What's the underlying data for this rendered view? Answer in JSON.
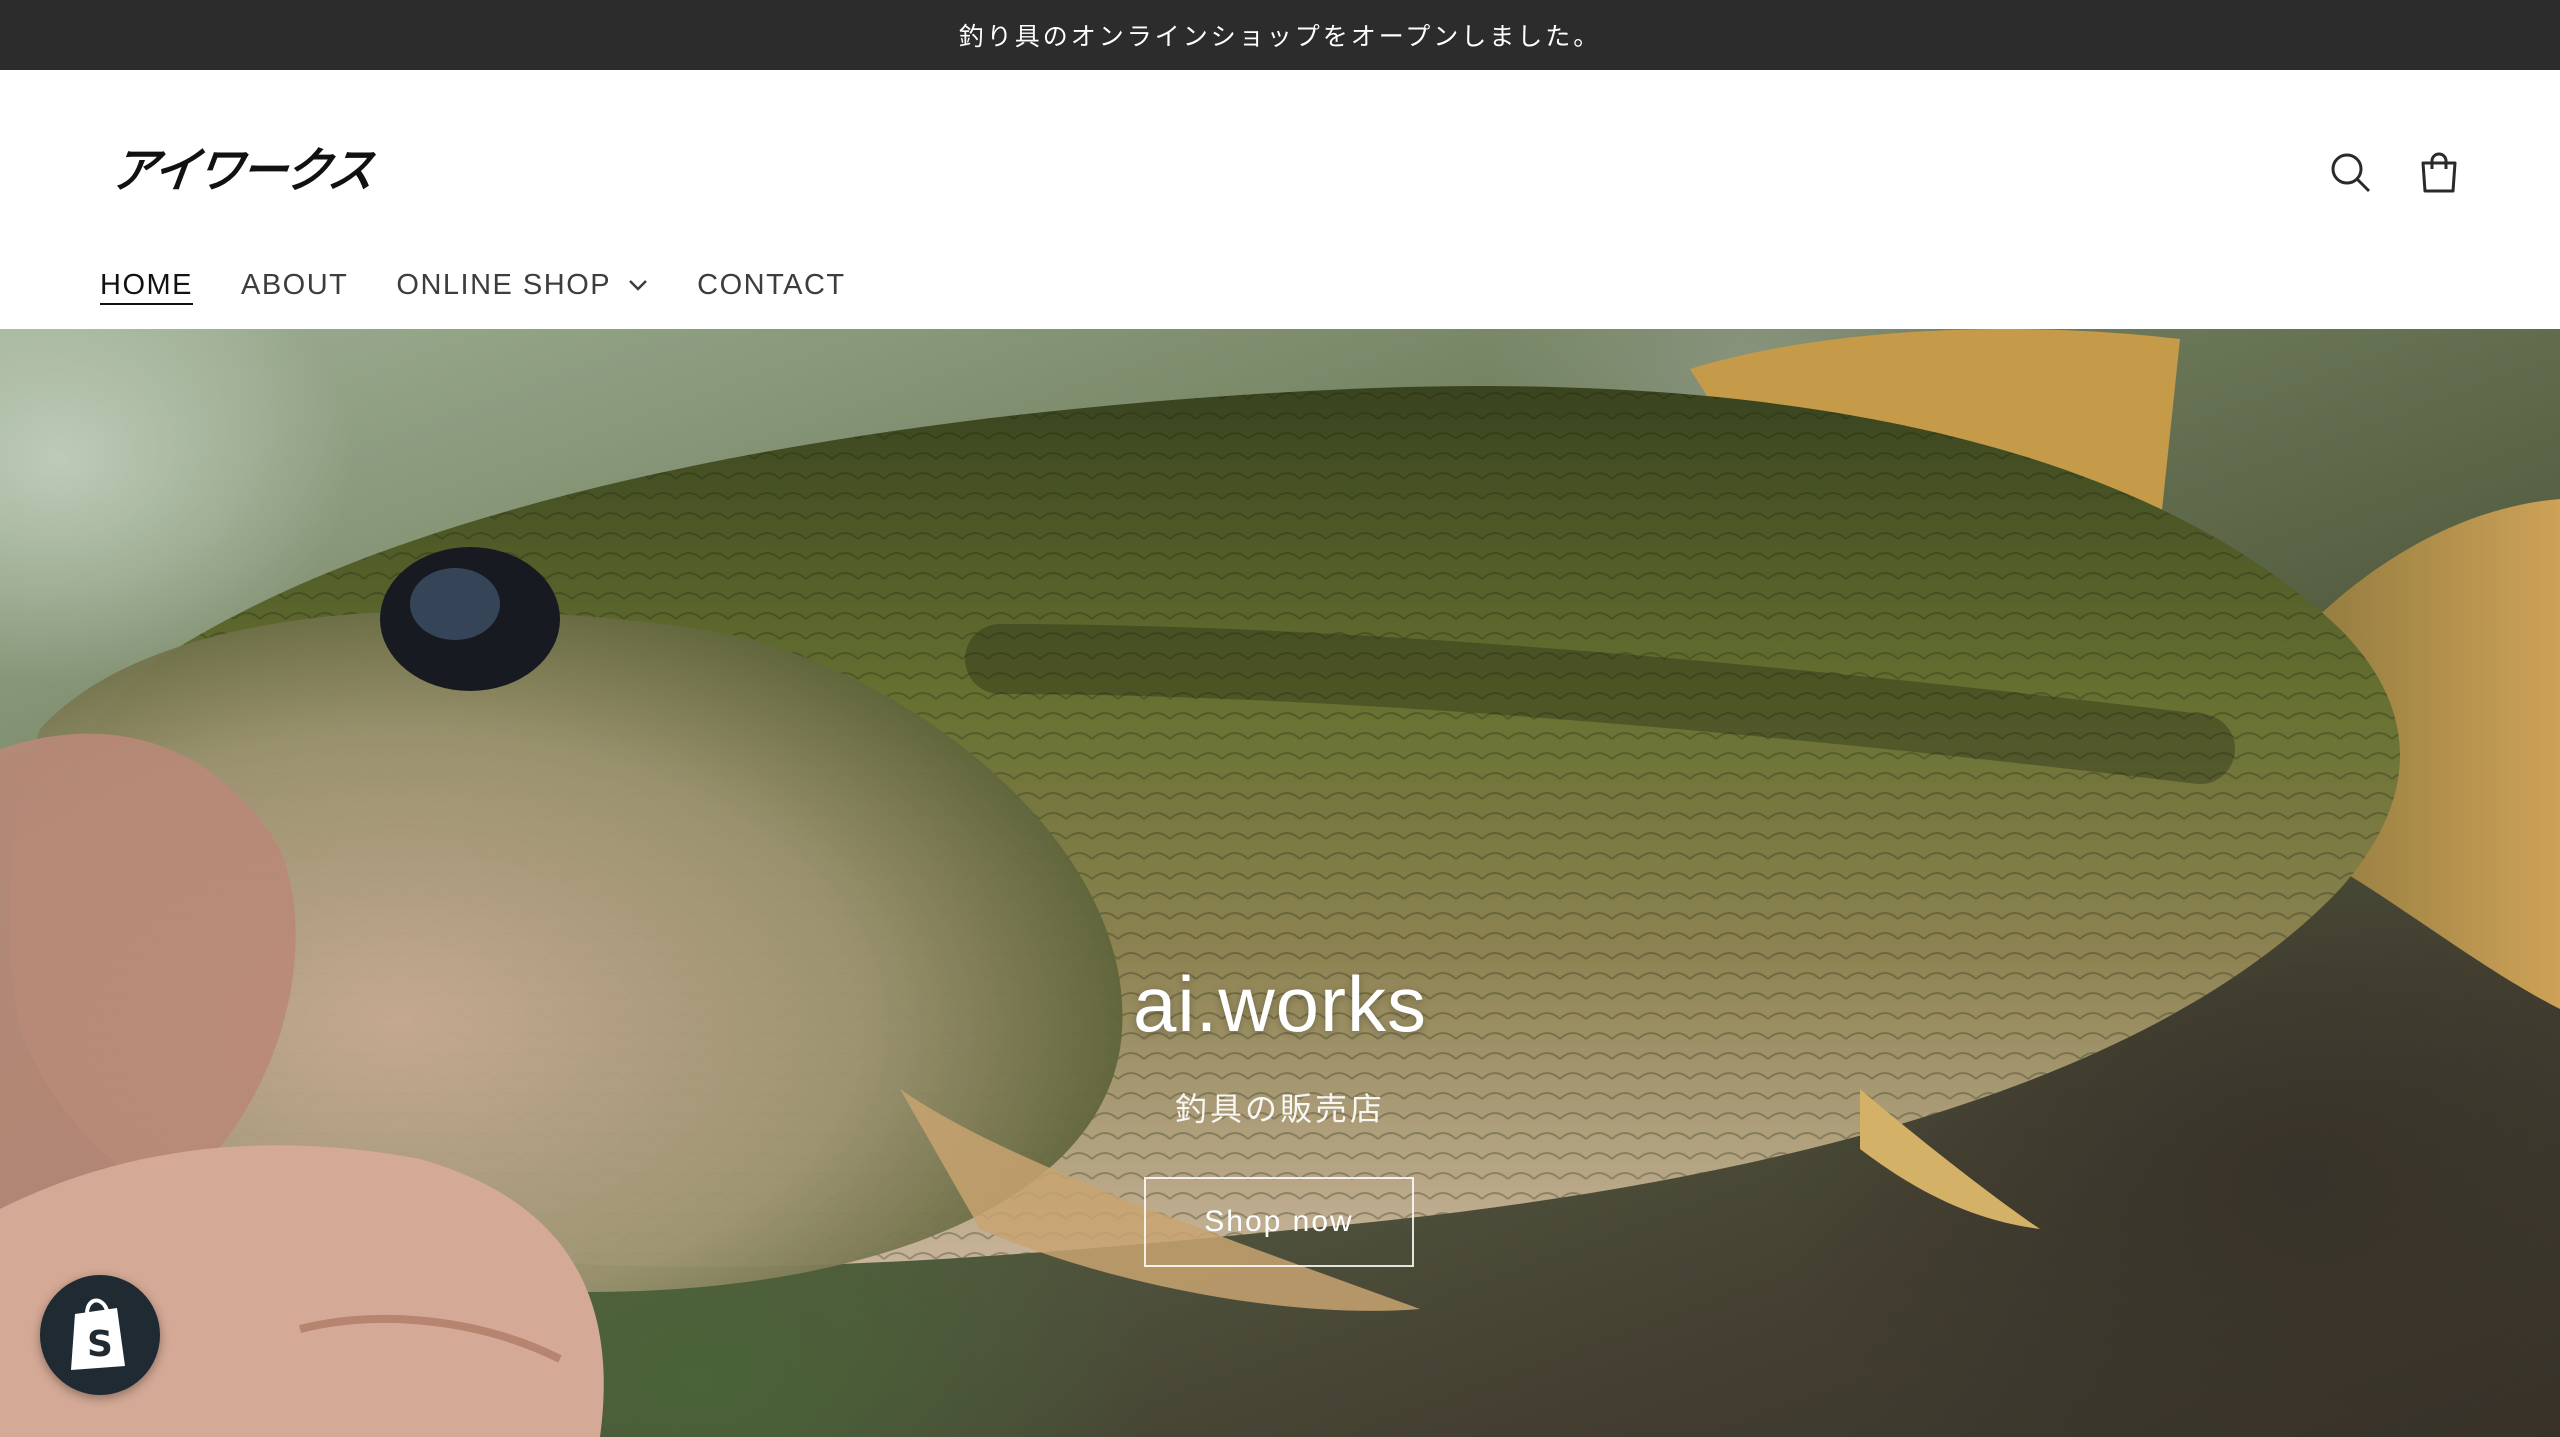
{
  "announcement": {
    "text": "釣り具のオンラインショップをオープンしました。"
  },
  "header": {
    "logo_text": "アイワークス",
    "icons": {
      "search": "search-icon",
      "cart": "cart-icon"
    }
  },
  "nav": {
    "items": [
      {
        "label": "HOME",
        "active": true
      },
      {
        "label": "ABOUT",
        "active": false
      },
      {
        "label": "ONLINE SHOP",
        "active": false,
        "dropdown": true
      },
      {
        "label": "CONTACT",
        "active": false
      }
    ]
  },
  "hero": {
    "title": "ai.works",
    "subtitle": "釣具の販売店",
    "button_label": "Shop now"
  },
  "badge": {
    "icon": "shopify-bag-icon"
  },
  "colors": {
    "announcement_bg": "#2c2c2c",
    "text_dark": "#121212",
    "badge_bg": "#1f2a33"
  }
}
